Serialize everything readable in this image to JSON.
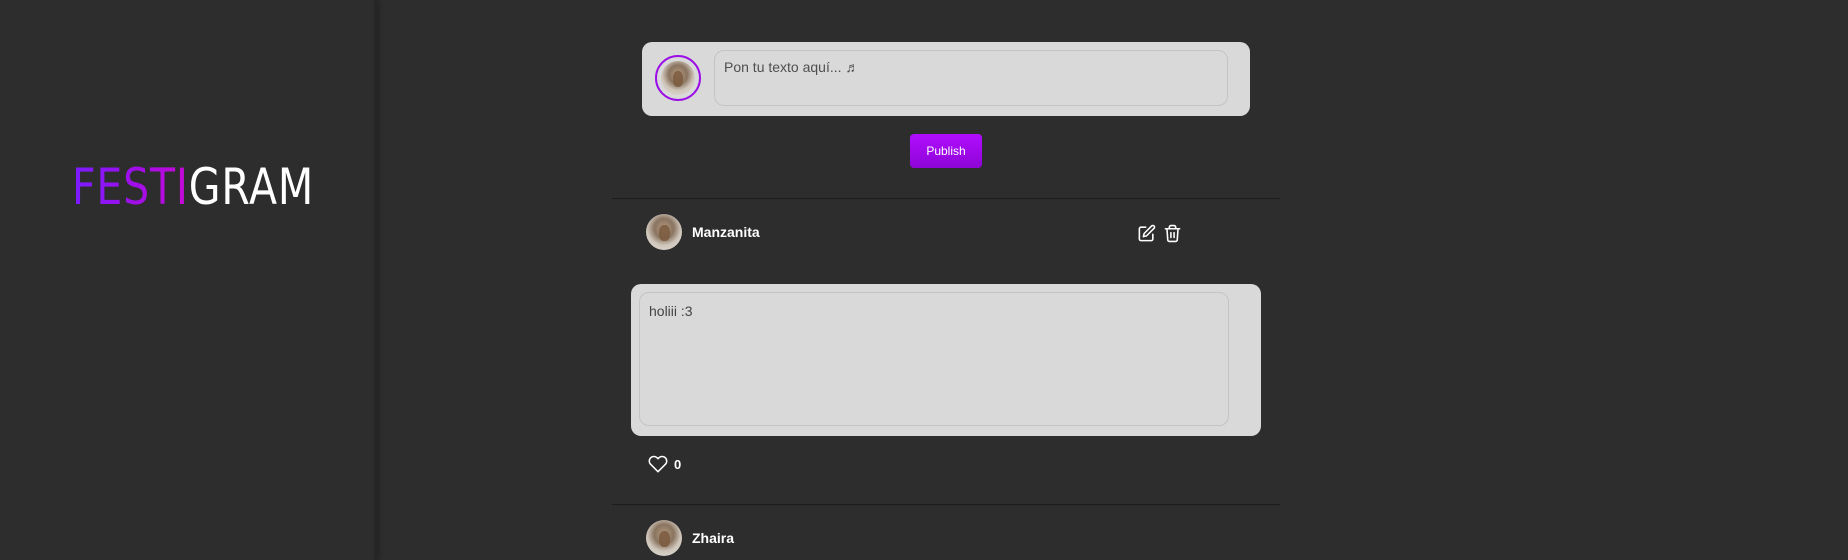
{
  "brand": {
    "logo_part1": "FESTI",
    "logo_part2": "GRAM",
    "gradient_colors": [
      "#7a1cff",
      "#c60ad6"
    ]
  },
  "composer": {
    "placeholder": "Pon tu texto aquí... ♬",
    "publish_label": "Publish",
    "accent_color": "#9b0fe6"
  },
  "posts": [
    {
      "username": "Manzanita",
      "text": "holiii :3",
      "likes": "0",
      "edit_icon": "edit-icon",
      "delete_icon": "trash-icon",
      "like_icon": "heart-icon"
    },
    {
      "username": "Zhaira"
    }
  ],
  "colors": {
    "background": "#2d2d2d",
    "card": "#d9d9d9",
    "text_on_dark": "#ffffff"
  }
}
